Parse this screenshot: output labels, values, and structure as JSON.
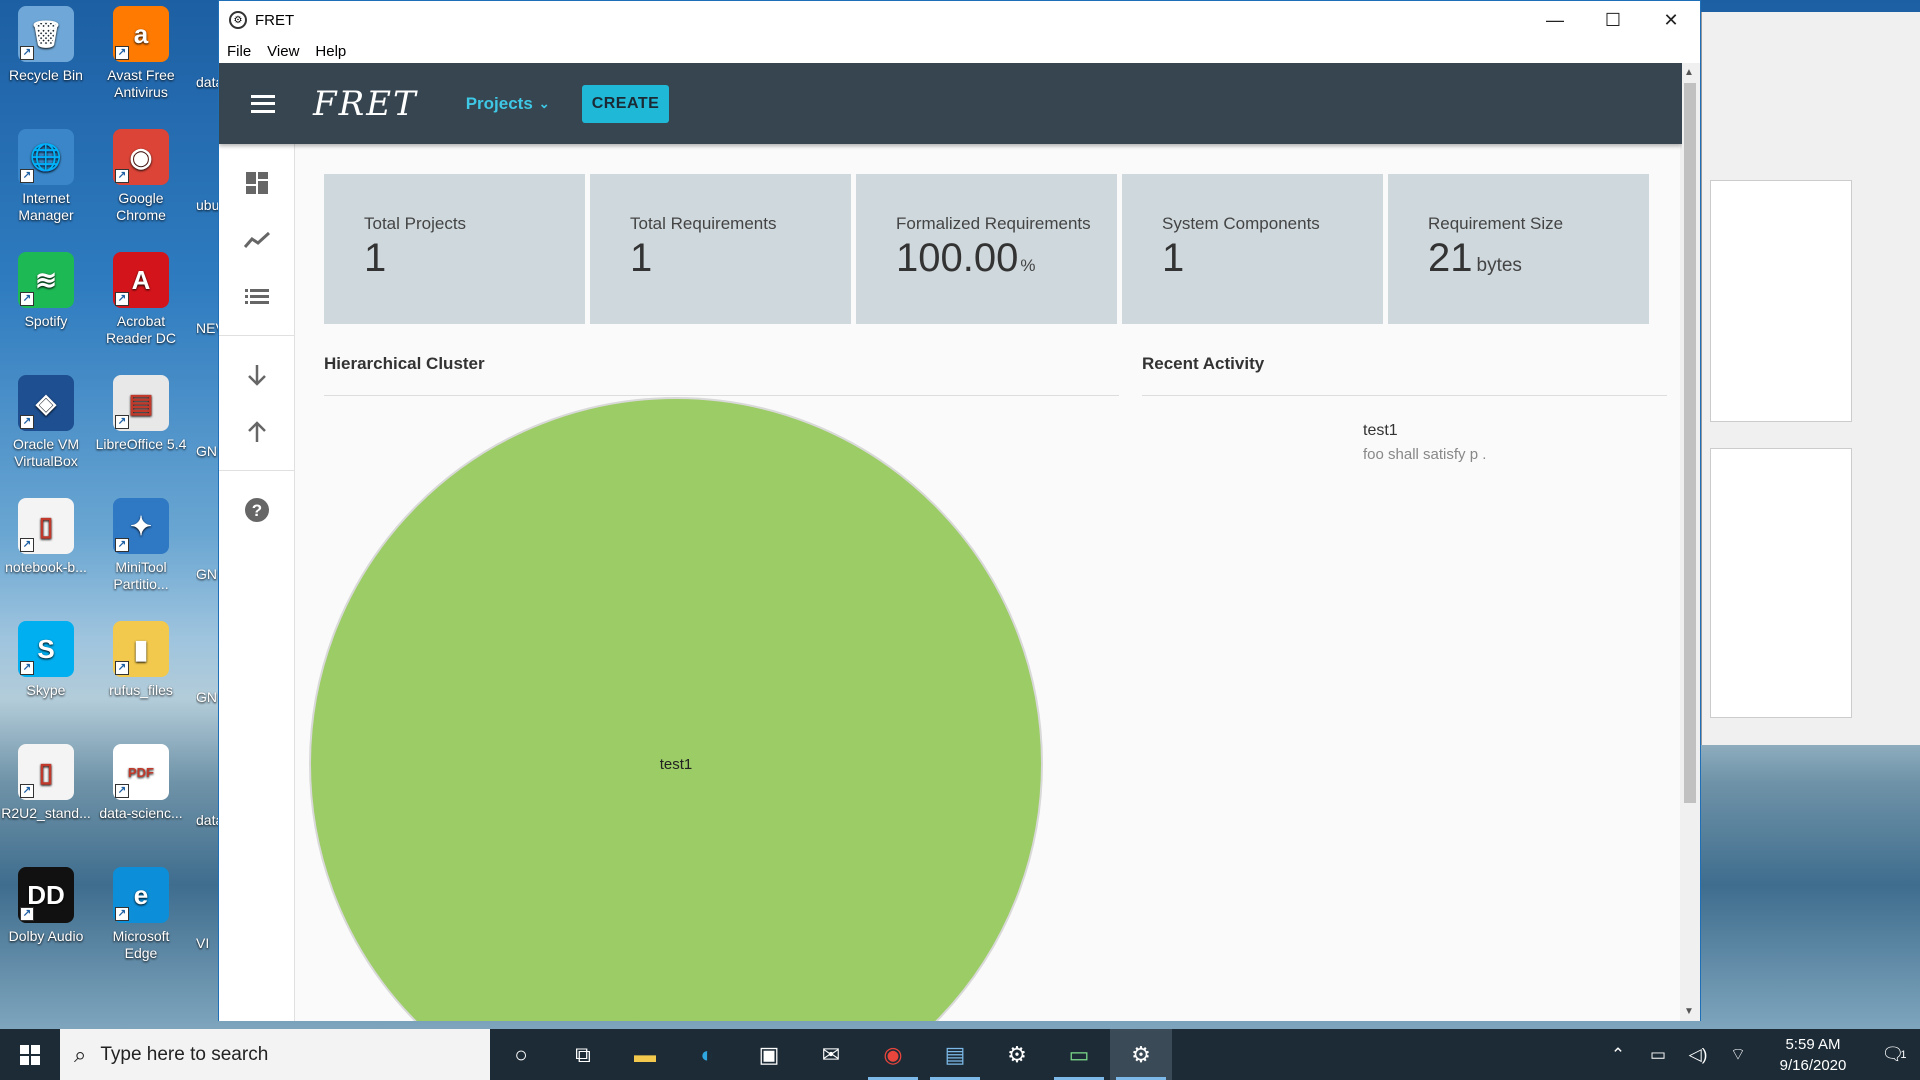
{
  "desktop": {
    "icons": [
      {
        "label": "Recycle Bin",
        "glyph": "🗑",
        "color": "#6fa8d8"
      },
      {
        "label": "Avast Free Antivirus",
        "glyph": "a",
        "color": "#ff7a00"
      },
      {
        "label": "Internet Manager",
        "glyph": "🌐",
        "color": "#3a86c8"
      },
      {
        "label": "Google Chrome",
        "glyph": "◉",
        "color": "#db4437"
      },
      {
        "label": "Spotify",
        "glyph": "≋",
        "color": "#1db954"
      },
      {
        "label": "Acrobat Reader DC",
        "glyph": "A",
        "color": "#d4141b"
      },
      {
        "label": "Oracle VM VirtualBox",
        "glyph": "◈",
        "color": "#1d4f91"
      },
      {
        "label": "LibreOffice 5.4",
        "glyph": "▤",
        "color": "#e8e8e8"
      },
      {
        "label": "notebook-b...",
        "glyph": "▯",
        "color": "#f4f4f4"
      },
      {
        "label": "MiniTool Partitio...",
        "glyph": "✦",
        "color": "#2f78c4"
      },
      {
        "label": "Skype",
        "glyph": "S",
        "color": "#00aff0"
      },
      {
        "label": "rufus_files",
        "glyph": "▮",
        "color": "#f2c94c"
      },
      {
        "label": "R2U2_stand...",
        "glyph": "▯",
        "color": "#f4f4f4"
      },
      {
        "label": "data-scienc...",
        "glyph": "PDF",
        "color": "#ffffff"
      },
      {
        "label": "Dolby Audio",
        "glyph": "DD",
        "color": "#111111"
      },
      {
        "label": "Microsoft Edge",
        "glyph": "e",
        "color": "#0c8ed9"
      }
    ],
    "partial_labels": [
      "data",
      "ubu",
      "NEV",
      "GN",
      "GN",
      "GN",
      "data",
      "VI"
    ]
  },
  "window": {
    "title": "FRET",
    "app_icon": "fret-logo-icon",
    "menu": [
      "File",
      "View",
      "Help"
    ],
    "controls": {
      "minimize": "—",
      "maximize": "☐",
      "close": "✕"
    }
  },
  "appbar": {
    "logo": "FRET",
    "projects_label": "Projects",
    "create_label": "CREATE"
  },
  "sidebar": {
    "icons": [
      "dashboard-icon",
      "analysis-icon",
      "requirements-list-icon",
      "import-icon",
      "export-icon",
      "help-icon"
    ]
  },
  "stats": [
    {
      "label": "Total Projects",
      "value": "1",
      "unit": ""
    },
    {
      "label": "Total Requirements",
      "value": "1",
      "unit": ""
    },
    {
      "label": "Formalized Requirements",
      "value": "100.00",
      "unit": "%"
    },
    {
      "label": "System Components",
      "value": "1",
      "unit": ""
    },
    {
      "label": "Requirement Size",
      "value": "21",
      "unit": "bytes"
    }
  ],
  "cluster": {
    "title": "Hierarchical Cluster",
    "node_label": "test1",
    "fill": "#9ccc65"
  },
  "activity": {
    "title": "Recent Activity",
    "items": [
      {
        "title": "test1",
        "text": "foo shall satisfy p ."
      }
    ]
  },
  "taskbar": {
    "search_placeholder": "Type here to search",
    "apps": [
      "cortana-icon",
      "task-view-icon",
      "file-explorer-icon",
      "edge-icon",
      "store-icon",
      "mail-icon",
      "chrome-icon",
      "writer-icon",
      "settings-icon",
      "terminal-icon",
      "fret-icon"
    ],
    "time": "5:59 AM",
    "date": "9/16/2020",
    "notification_count": "1"
  }
}
